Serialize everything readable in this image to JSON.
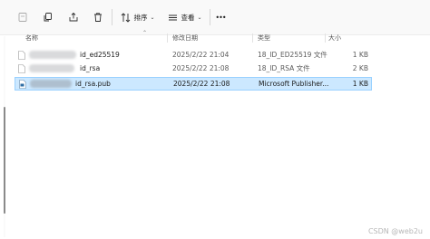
{
  "toolbar": {
    "sort_label": "排序",
    "view_label": "查看",
    "more_label": "•••"
  },
  "columns": {
    "name": "名称",
    "date": "修改日期",
    "type": "类型",
    "size": "大小"
  },
  "files": [
    {
      "name": "id_ed25519",
      "date": "2025/2/22 21:04",
      "type": "18_ID_ED25519 文件",
      "size": "1 KB"
    },
    {
      "name": "id_rsa",
      "date": "2025/2/22 21:08",
      "type": "18_ID_RSA 文件",
      "size": "2 KB"
    },
    {
      "name": "id_rsa.pub",
      "date": "2025/2/22 21:08",
      "type": "Microsoft Publisher...",
      "size": "1 KB"
    }
  ],
  "watermark": "CSDN @web2u",
  "colors": {
    "selection_bg": "#cce8ff",
    "selection_border": "#99d1ff"
  }
}
